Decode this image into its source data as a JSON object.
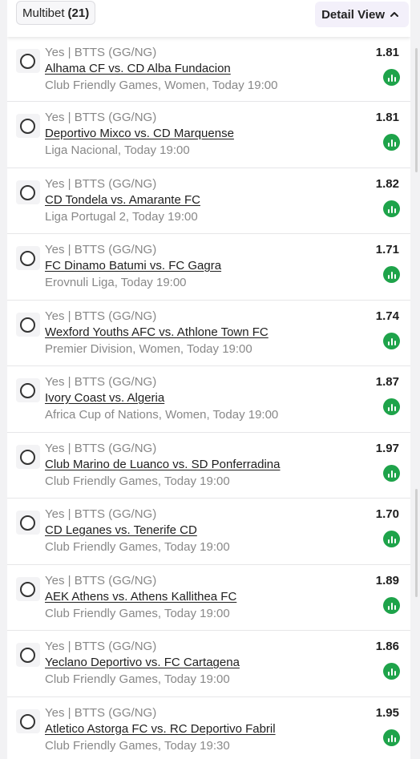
{
  "header": {
    "multibet_label": "Multibet",
    "multibet_count": "(21)",
    "detail_view_label": "Detail View"
  },
  "bets": [
    {
      "market": "Yes | BTTS (GG/NG)",
      "match": "Alhama CF vs. CD Alba Fundacion",
      "league": "Club Friendly Games, Women, Today 19:00",
      "odds": "1.81"
    },
    {
      "market": "Yes | BTTS (GG/NG)",
      "match": "Deportivo Mixco vs. CD Marquense",
      "league": "Liga Nacional, Today 19:00",
      "odds": "1.81"
    },
    {
      "market": "Yes | BTTS (GG/NG)",
      "match": "CD Tondela vs. Amarante FC",
      "league": "Liga Portugal 2, Today 19:00",
      "odds": "1.82"
    },
    {
      "market": "Yes | BTTS (GG/NG)",
      "match": "FC Dinamo Batumi vs. FC Gagra",
      "league": "Erovnuli Liga, Today 19:00",
      "odds": "1.71"
    },
    {
      "market": "Yes | BTTS (GG/NG)",
      "match": "Wexford Youths AFC vs. Athlone Town FC",
      "league": "Premier Division, Women, Today 19:00",
      "odds": "1.74"
    },
    {
      "market": "Yes | BTTS (GG/NG)",
      "match": "Ivory Coast vs. Algeria",
      "league": "Africa Cup of Nations, Women, Today 19:00",
      "odds": "1.87"
    },
    {
      "market": "Yes | BTTS (GG/NG)",
      "match": "Club Marino de Luanco vs. SD Ponferradina",
      "league": "Club Friendly Games, Today 19:00",
      "odds": "1.97"
    },
    {
      "market": "Yes | BTTS (GG/NG)",
      "match": "CD Leganes vs. Tenerife CD",
      "league": "Club Friendly Games, Today 19:00",
      "odds": "1.70"
    },
    {
      "market": "Yes | BTTS (GG/NG)",
      "match": "AEK Athens vs. Athens Kallithea FC",
      "league": "Club Friendly Games, Today 19:00",
      "odds": "1.89"
    },
    {
      "market": "Yes | BTTS (GG/NG)",
      "match": "Yeclano Deportivo vs. FC Cartagena",
      "league": "Club Friendly Games, Today 19:00",
      "odds": "1.86"
    },
    {
      "market": "Yes | BTTS (GG/NG)",
      "match": "Atletico Astorga FC vs. RC Deportivo Fabril",
      "league": "Club Friendly Games, Today 19:30",
      "odds": "1.95"
    }
  ],
  "icons": {
    "radio": "radio-unchecked-icon",
    "stats": "stats-bar-chart-icon",
    "chevron": "chevron-up-icon"
  },
  "colors": {
    "stats_green": "#1ea34a",
    "detail_bg": "#f3f0fa"
  }
}
